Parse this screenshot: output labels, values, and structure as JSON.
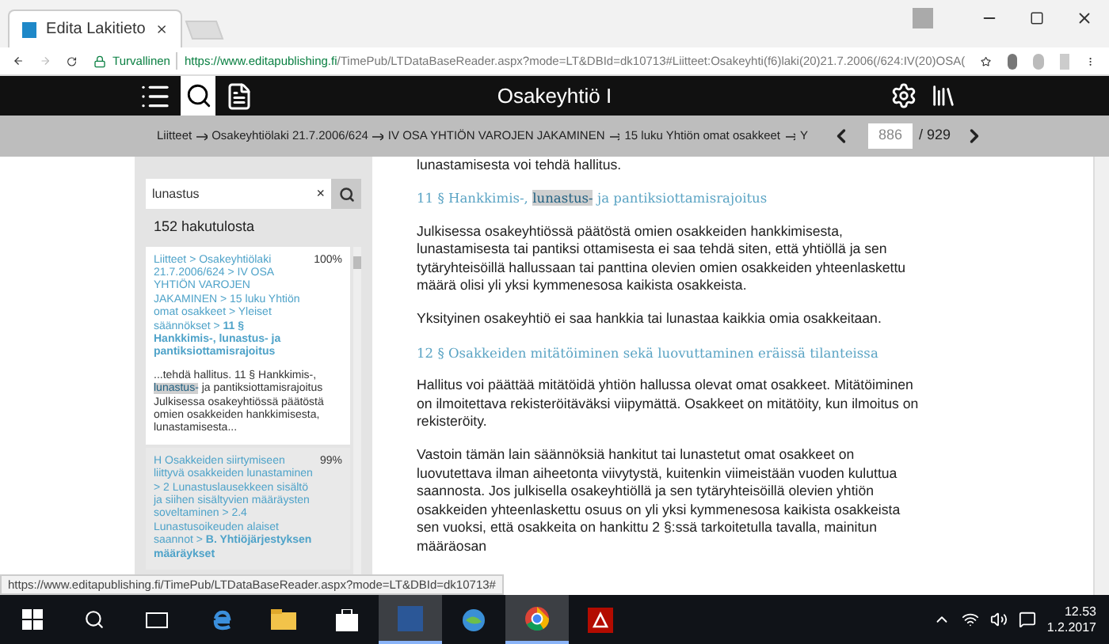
{
  "browser": {
    "tabs": [
      {
        "title": "Edita Lakitieto",
        "selected": true
      }
    ],
    "security": "Turvallinen",
    "url_host": "https://www.editapublishing.fi",
    "url_path": "/TimePub/LTDataBaseReader.aspx?mode=LT&DBId=dk10713#Liitteet:Osakeyhti(f6)laki(20)21.7.2006(/624:IV(20)OSA("
  },
  "app_bar": {
    "title": "Osakeyhtiö I"
  },
  "breadcrumb": [
    "Liitteet",
    "Osakeyhtiölaki 21.7.2006/624",
    "IV OSA YHTIÖN VAROJEN JAKAMINEN",
    "15 luku Yhtiön omat osakkeet",
    "Y"
  ],
  "pager": {
    "page": "886",
    "total": "/ 929"
  },
  "search": {
    "value": "lunastus",
    "clear": "×",
    "count": "152 hakutulosta",
    "results": [
      {
        "selected": true,
        "path": "Liitteet > Osakeyhtiölaki 21.7.2006/624 > IV OSA YHTIÖN VAROJEN JAKAMINEN > 15 luku Yhtiön omat osakkeet > Yleiset säännökset > **11 § Hankkimis-, lunastus- ja pantiksiottamisrajoitus**",
        "score": "100%",
        "snippet": [
          {
            "text": "...tehdä hallitus. 11 § Hankkimis-, ",
            "highlighted": false
          },
          {
            "text": "lunastus-",
            "highlighted": true
          },
          {
            "text": " ja pantiksiottamisrajoitus Julkisessa osakeyhtiössä päätöstä omien osakkeiden hankkimisesta, lunastamisesta...",
            "highlighted": false
          }
        ]
      },
      {
        "selected": false,
        "path": "H Osakkeiden siirtymiseen liittyvä osakkeiden lunastaminen > 2 Lunastuslausekkeen sisältö ja siihen sisältyvien määräysten soveltaminen > 2.4 Lunastusoikeuden alaiset saannot > **B. Yhtiöjärjestyksen määräykset**",
        "score": "99%"
      }
    ]
  },
  "document": [
    {
      "kind": "paragraph",
      "text": "lunastamisesta voi tehdä hallitus."
    },
    {
      "kind": "heading",
      "parts": [
        {
          "text": "11 § Hankkimis-, ",
          "highlighted": false
        },
        {
          "text": "lunastus-",
          "highlighted": true
        },
        {
          "text": " ja pantiksiottamisrajoitus",
          "highlighted": false
        }
      ]
    },
    {
      "kind": "paragraph",
      "text": "Julkisessa osakeyhtiössä päätöstä omien osakkeiden hankkimisesta, lunastamisesta tai pantiksi ottamisesta ei saa tehdä siten, että yhtiöllä ja sen tytäryhteisöillä hallussaan tai panttina olevien omien osakkeiden yhteenlaskettu määrä olisi yli yksi kymmenesosa kaikista osakkeista."
    },
    {
      "kind": "paragraph",
      "text": "Yksityinen osakeyhtiö ei saa hankkia tai lunastaa kaikkia omia osakkeitaan."
    },
    {
      "kind": "heading",
      "parts": [
        {
          "text": "12 § Osakkeiden mitätöiminen sekä luovuttaminen eräissä tilanteissa",
          "highlighted": false
        }
      ]
    },
    {
      "kind": "paragraph",
      "text": "Hallitus voi päättää mitätöidä yhtiön hallussa olevat omat osakkeet. Mitätöiminen on ilmoitettava rekisteröitäväksi viipymättä. Osakkeet on mitätöity, kun ilmoitus on rekisteröity."
    },
    {
      "kind": "paragraph",
      "text": "Vastoin tämän lain säännöksiä hankitut tai lunastetut omat osakkeet on luovutettava ilman aiheetonta viivytystä, kuitenkin viimeistään vuoden kuluttua saannosta. Jos julkisella osakeyhtiöllä ja sen tytäryhteisöillä olevien yhtiön osakkeiden yhteenlaskettu osuus on yli yksi kymmenesosa kaikista osakkeista sen vuoksi, että osakkeita on hankittu 2 §:ssä tarkoitetulla tavalla, mainitun määräosan"
    }
  ],
  "status_url": "https://www.editapublishing.fi/TimePub/LTDataBaseReader.aspx?mode=LT&DBId=dk10713#",
  "taskbar": {
    "apps": [
      {
        "kind": "edge",
        "active": false
      },
      {
        "kind": "folder",
        "active": false
      },
      {
        "kind": "store",
        "active": false
      },
      {
        "kind": "word",
        "active": true
      },
      {
        "kind": "globe",
        "active": false
      },
      {
        "kind": "chrome",
        "active": true
      },
      {
        "kind": "pdf",
        "active": false
      }
    ],
    "time": "12.53",
    "date": "1.2.2017"
  }
}
